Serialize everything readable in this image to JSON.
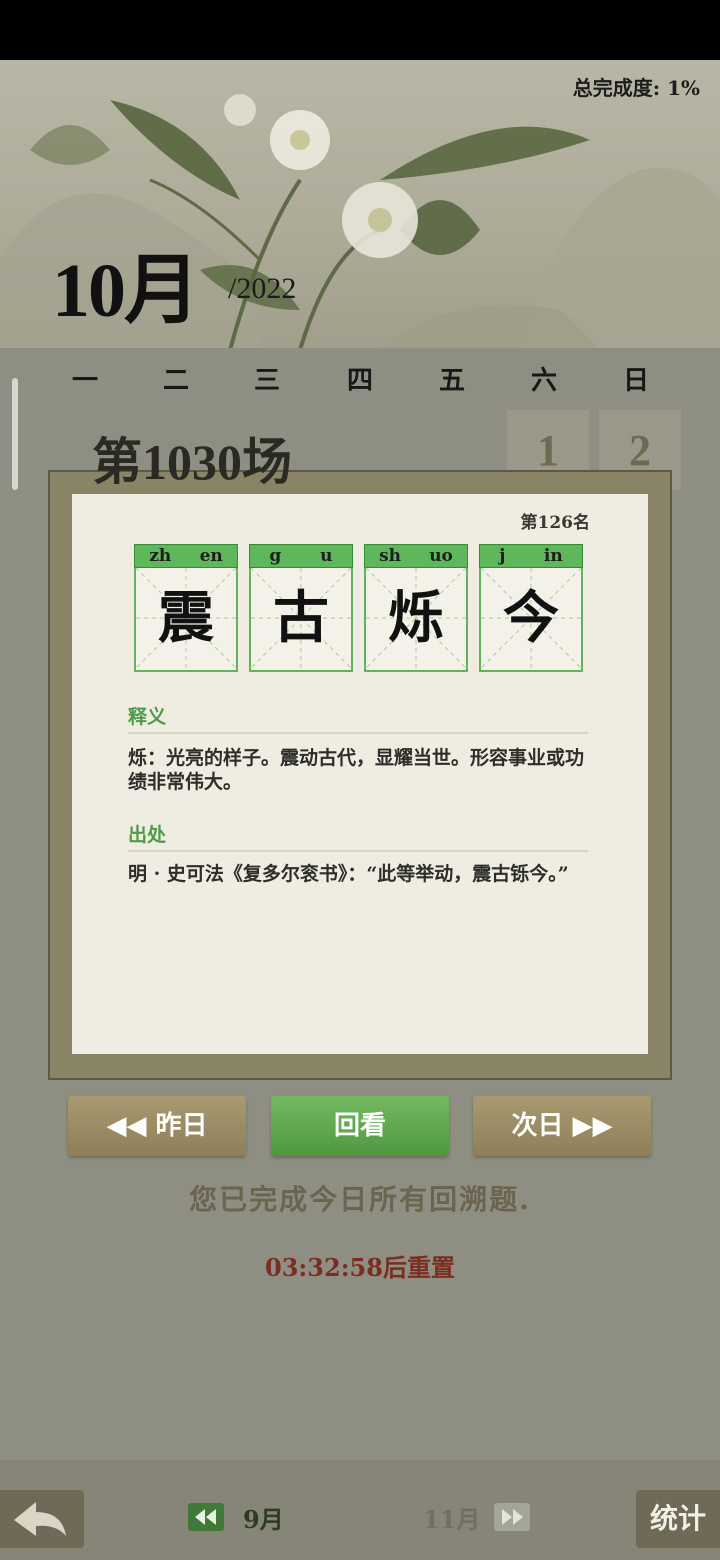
{
  "header": {
    "progress_label": "总完成度: 1%",
    "month": "10月",
    "year": "/2022"
  },
  "weekdays": [
    "一",
    "二",
    "三",
    "四",
    "五",
    "六",
    "日"
  ],
  "calendar_days": [
    "1",
    "2"
  ],
  "round_title": "第1030场",
  "modal": {
    "rank": "第126名",
    "idiom": [
      {
        "initial": "zh",
        "final": "en",
        "char": "震"
      },
      {
        "initial": "g",
        "final": "u",
        "char": "古"
      },
      {
        "initial": "sh",
        "final": "uo",
        "char": "烁"
      },
      {
        "initial": "j",
        "final": "in",
        "char": "今"
      }
    ],
    "meaning_head": "释义",
    "meaning_text": "烁：光亮的样子。震动古代，显耀当世。形容事业或功绩非常伟大。",
    "source_head": "出处",
    "source_text": "明 · 史可法《复多尔衮书》：“此等举动，震古铄今。”"
  },
  "buttons": {
    "prev_day": "◀◀ 昨日",
    "review": "回看",
    "next_day": "次日 ▶▶"
  },
  "done_message": "您已完成今日所有回溯题.",
  "reset_timer": "03:32:58后重置",
  "bottom": {
    "prev_month": "9月",
    "next_month": "11月",
    "stats": "统计"
  },
  "colors": {
    "accent_green": "#5fb75b",
    "tan_button": "#9d8d66",
    "timer_red": "#7a2e22"
  }
}
